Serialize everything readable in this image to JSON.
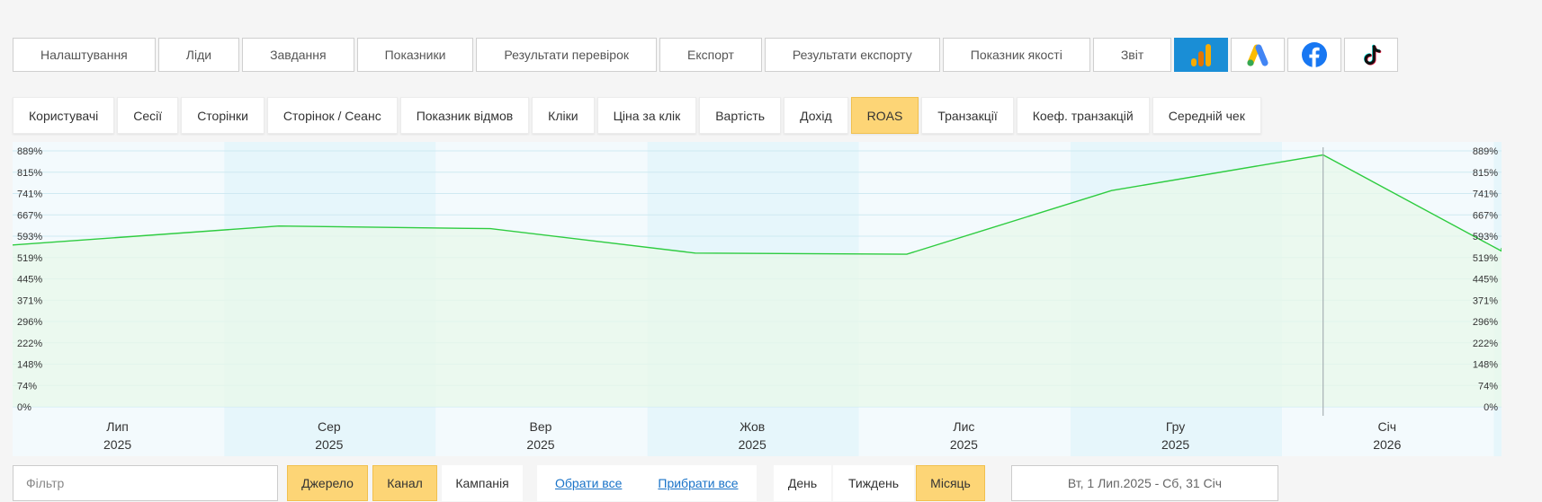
{
  "topnav": {
    "items": [
      "Налаштування",
      "Ліди",
      "Завдання",
      "Показники",
      "Результати перевірок",
      "Експорт",
      "Результати експорту",
      "Показник якості",
      "Звіт"
    ],
    "brands": [
      {
        "name": "google-analytics-icon",
        "active": true
      },
      {
        "name": "google-ads-icon",
        "active": false
      },
      {
        "name": "facebook-icon",
        "active": false
      },
      {
        "name": "tiktok-icon",
        "active": false
      }
    ]
  },
  "metrics": {
    "items": [
      "Користувачі",
      "Сесії",
      "Сторінки",
      "Сторінок / Сеанс",
      "Показник відмов",
      "Кліки",
      "Ціна за клік",
      "Вартість",
      "Дохід",
      "ROAS",
      "Транзакції",
      "Коеф. транзакцій",
      "Середній чек"
    ],
    "active": "ROAS"
  },
  "chart_data": {
    "type": "line",
    "x": [
      "Лип 2025",
      "Сер 2025",
      "Вер 2025",
      "Жов 2025",
      "Лис 2025",
      "Гру 2025",
      "Січ 2026"
    ],
    "x_labels": [
      {
        "month": "Лип",
        "year": "2025"
      },
      {
        "month": "Сер",
        "year": "2025"
      },
      {
        "month": "Вер",
        "year": "2025"
      },
      {
        "month": "Жов",
        "year": "2025"
      },
      {
        "month": "Лис",
        "year": "2025"
      },
      {
        "month": "Гру",
        "year": "2025"
      },
      {
        "month": "Січ",
        "year": "2026"
      }
    ],
    "points": [
      {
        "x": "2025-06-22",
        "y": 562
      },
      {
        "x": "2025-07-31",
        "y": 628
      },
      {
        "x": "2025-08-31",
        "y": 619
      },
      {
        "x": "2025-09-30",
        "y": 534
      },
      {
        "x": "2025-10-31",
        "y": 530
      },
      {
        "x": "2025-11-30",
        "y": 751
      },
      {
        "x": "2025-12-31",
        "y": 875
      },
      {
        "x": "2026-01-31",
        "y": 541
      },
      {
        "x": "2026-02-06",
        "y": 552
      }
    ],
    "y_ticks": [
      "0%",
      "74%",
      "148%",
      "222%",
      "296%",
      "371%",
      "445%",
      "519%",
      "593%",
      "667%",
      "741%",
      "815%",
      "889%"
    ],
    "ylim": [
      0,
      889
    ],
    "y_unit": "%",
    "grid": true,
    "line_color": "#2ecc40",
    "fill_color": "#e8f8ea",
    "marker_x": "2025-12-31"
  },
  "bottom": {
    "filter_placeholder": "Фільтр",
    "group_tabs": [
      {
        "label": "Джерело",
        "active": true
      },
      {
        "label": "Канал",
        "active": true
      },
      {
        "label": "Кампанія",
        "active": false
      }
    ],
    "links": [
      "Обрати все",
      "Прибрати все"
    ],
    "periods": [
      {
        "label": "День",
        "active": false
      },
      {
        "label": "Тиждень",
        "active": false
      },
      {
        "label": "Місяць",
        "active": true
      }
    ],
    "date_range": "Вт, 1 Лип.2025 - Сб, 31 Січ"
  },
  "colors": {
    "accent": "#fdd576",
    "accent_border": "#f1c04e",
    "brand_active": "#1a8ed6",
    "link": "#1a73c8"
  }
}
